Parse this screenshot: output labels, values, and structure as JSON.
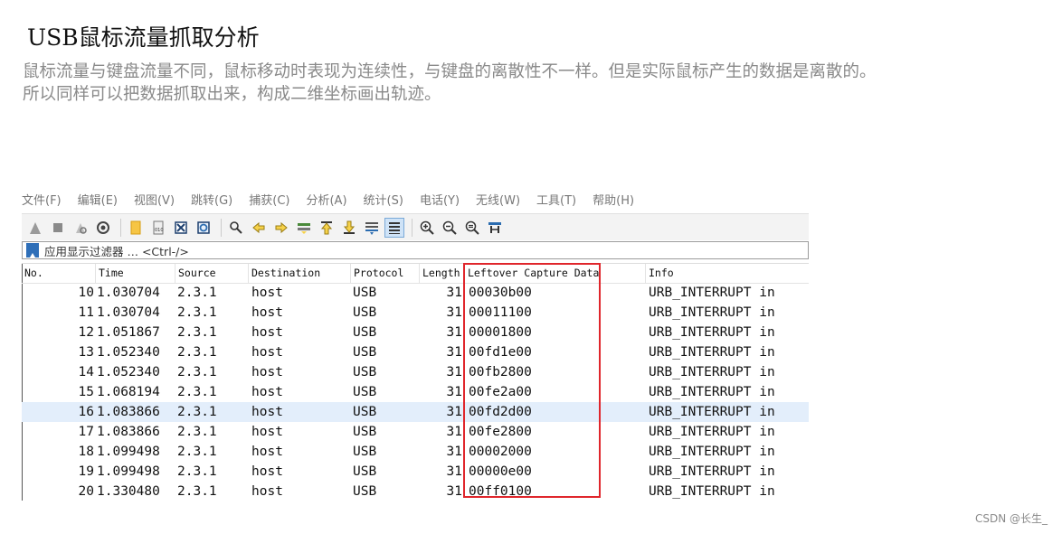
{
  "heading": "USB鼠标流量抓取分析",
  "description": "鼠标流量与键盘流量不同，鼠标移动时表现为连续性，与键盘的离散性不一样。但是实际鼠标产生的数据是离散的。所以同样可以把数据抓取出来，构成二维坐标画出轨迹。",
  "menu": [
    "文件(F)",
    "编辑(E)",
    "视图(V)",
    "跳转(G)",
    "捕获(C)",
    "分析(A)",
    "统计(S)",
    "电话(Y)",
    "无线(W)",
    "工具(T)",
    "帮助(H)"
  ],
  "filter": {
    "text": "应用显示过滤器 … <Ctrl-/>"
  },
  "columns": [
    "No.",
    "Time",
    "Source",
    "Destination",
    "Protocol",
    "Length",
    "Leftover Capture Data",
    "Info"
  ],
  "rows": [
    {
      "no": "10",
      "time": "1.030704",
      "source": "2.3.1",
      "destination": "host",
      "protocol": "USB",
      "length": "31",
      "data": "00030b00",
      "info": "URB_INTERRUPT in"
    },
    {
      "no": "11",
      "time": "1.030704",
      "source": "2.3.1",
      "destination": "host",
      "protocol": "USB",
      "length": "31",
      "data": "00011100",
      "info": "URB_INTERRUPT in"
    },
    {
      "no": "12",
      "time": "1.051867",
      "source": "2.3.1",
      "destination": "host",
      "protocol": "USB",
      "length": "31",
      "data": "00001800",
      "info": "URB_INTERRUPT in"
    },
    {
      "no": "13",
      "time": "1.052340",
      "source": "2.3.1",
      "destination": "host",
      "protocol": "USB",
      "length": "31",
      "data": "00fd1e00",
      "info": "URB_INTERRUPT in"
    },
    {
      "no": "14",
      "time": "1.052340",
      "source": "2.3.1",
      "destination": "host",
      "protocol": "USB",
      "length": "31",
      "data": "00fb2800",
      "info": "URB_INTERRUPT in"
    },
    {
      "no": "15",
      "time": "1.068194",
      "source": "2.3.1",
      "destination": "host",
      "protocol": "USB",
      "length": "31",
      "data": "00fe2a00",
      "info": "URB_INTERRUPT in"
    },
    {
      "no": "16",
      "time": "1.083866",
      "source": "2.3.1",
      "destination": "host",
      "protocol": "USB",
      "length": "31",
      "data": "00fd2d00",
      "info": "URB_INTERRUPT in",
      "selected": true
    },
    {
      "no": "17",
      "time": "1.083866",
      "source": "2.3.1",
      "destination": "host",
      "protocol": "USB",
      "length": "31",
      "data": "00fe2800",
      "info": "URB_INTERRUPT in"
    },
    {
      "no": "18",
      "time": "1.099498",
      "source": "2.3.1",
      "destination": "host",
      "protocol": "USB",
      "length": "31",
      "data": "00002000",
      "info": "URB_INTERRUPT in"
    },
    {
      "no": "19",
      "time": "1.099498",
      "source": "2.3.1",
      "destination": "host",
      "protocol": "USB",
      "length": "31",
      "data": "00000e00",
      "info": "URB_INTERRUPT in"
    },
    {
      "no": "20",
      "time": "1.330480",
      "source": "2.3.1",
      "destination": "host",
      "protocol": "USB",
      "length": "31",
      "data": "00ff0100",
      "info": "URB_INTERRUPT in"
    }
  ],
  "highlight_color": "#e0262c",
  "selected_row_color": "#e3eefb",
  "watermark": "CSDN @长生_",
  "toolbar_icons": [
    "shark-fin-start-icon",
    "stop-icon",
    "restart-icon",
    "capture-options-icon",
    "open-file-icon",
    "save-file-icon",
    "close-file-icon",
    "reload-icon",
    "find-icon",
    "go-back-icon",
    "go-forward-icon",
    "go-to-packet-icon",
    "first-packet-icon",
    "last-packet-icon",
    "autoscroll-icon",
    "colorize-icon",
    "zoom-in-icon",
    "zoom-out-icon",
    "normal-size-icon",
    "resize-columns-icon"
  ]
}
